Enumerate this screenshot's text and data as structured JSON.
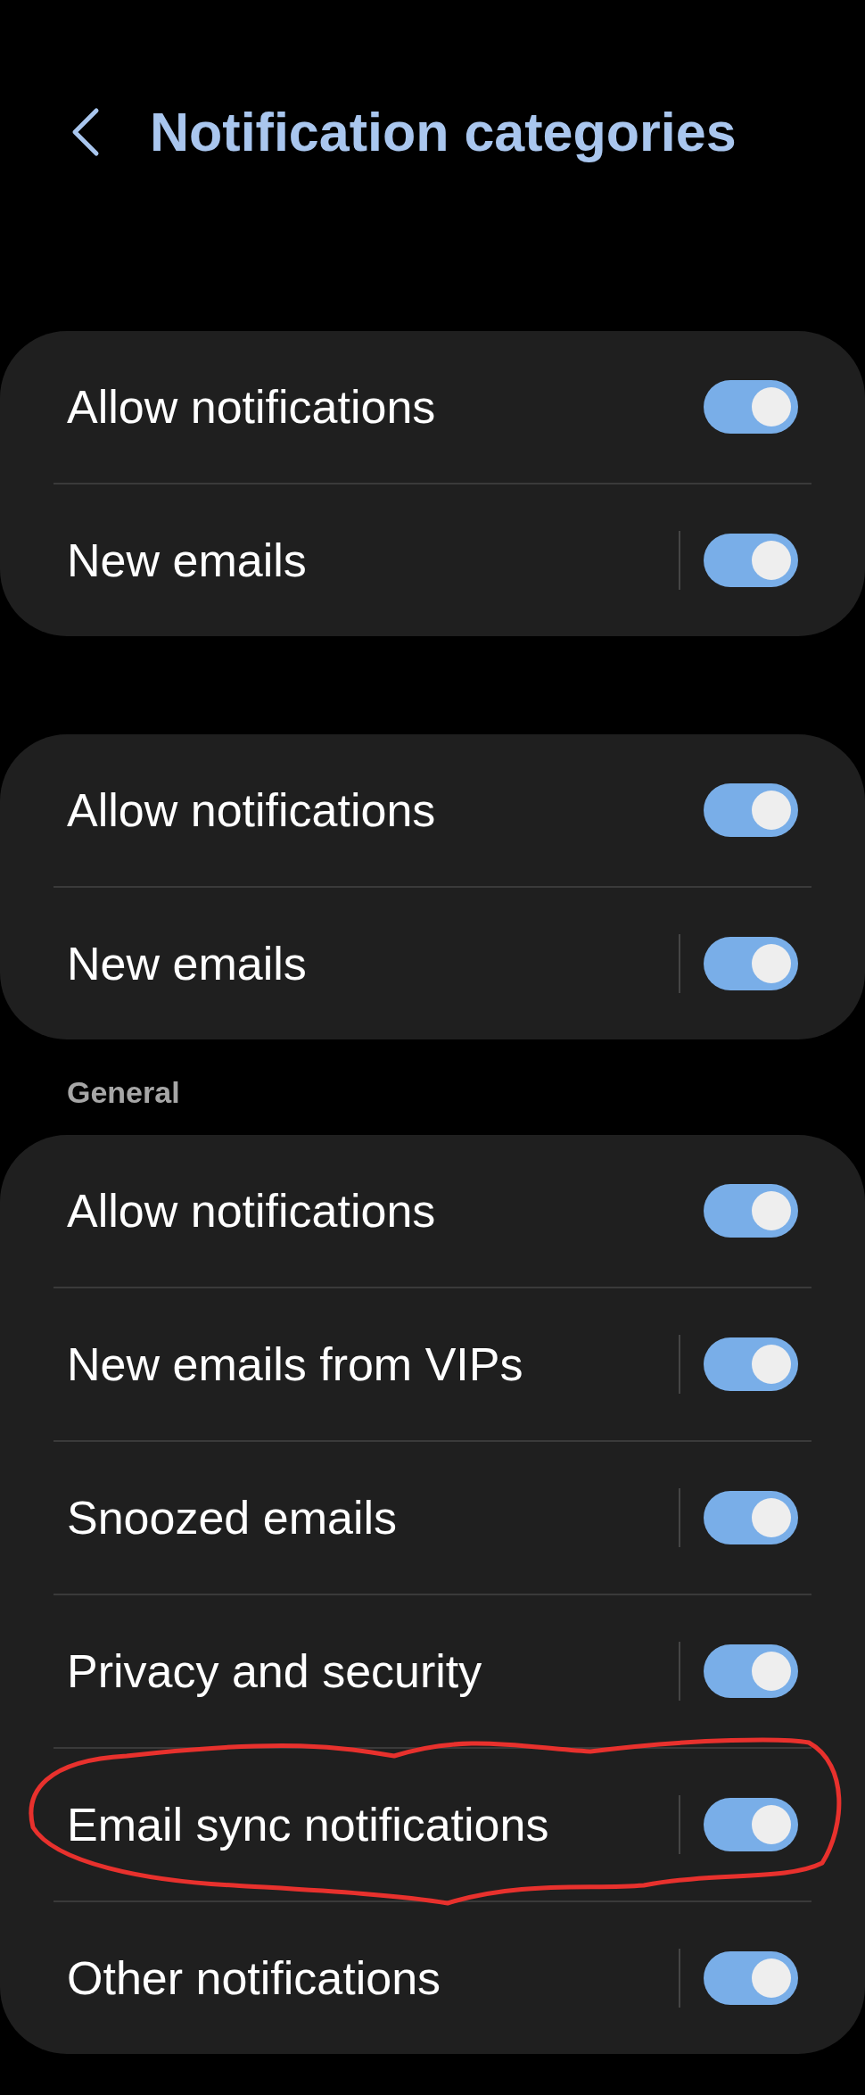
{
  "header": {
    "title": "Notification categories"
  },
  "sections": [
    {
      "rows": [
        {
          "kind": "master",
          "label": "Allow notifications",
          "on": true
        },
        {
          "kind": "channel",
          "label": "New emails",
          "on": true
        }
      ]
    },
    {
      "rows": [
        {
          "kind": "master",
          "label": "Allow notifications",
          "on": true
        },
        {
          "kind": "channel",
          "label": "New emails",
          "on": true
        }
      ]
    },
    {
      "heading": "General",
      "rows": [
        {
          "kind": "master",
          "label": "Allow notifications",
          "on": true
        },
        {
          "kind": "channel",
          "label": "New emails from VIPs",
          "on": true
        },
        {
          "kind": "channel",
          "label": "Snoozed emails",
          "on": true
        },
        {
          "kind": "channel",
          "label": "Privacy and security",
          "on": true
        },
        {
          "kind": "channel",
          "label": "Email sync notifications",
          "on": true
        },
        {
          "kind": "channel",
          "label": "Other notifications",
          "on": true
        }
      ]
    }
  ]
}
